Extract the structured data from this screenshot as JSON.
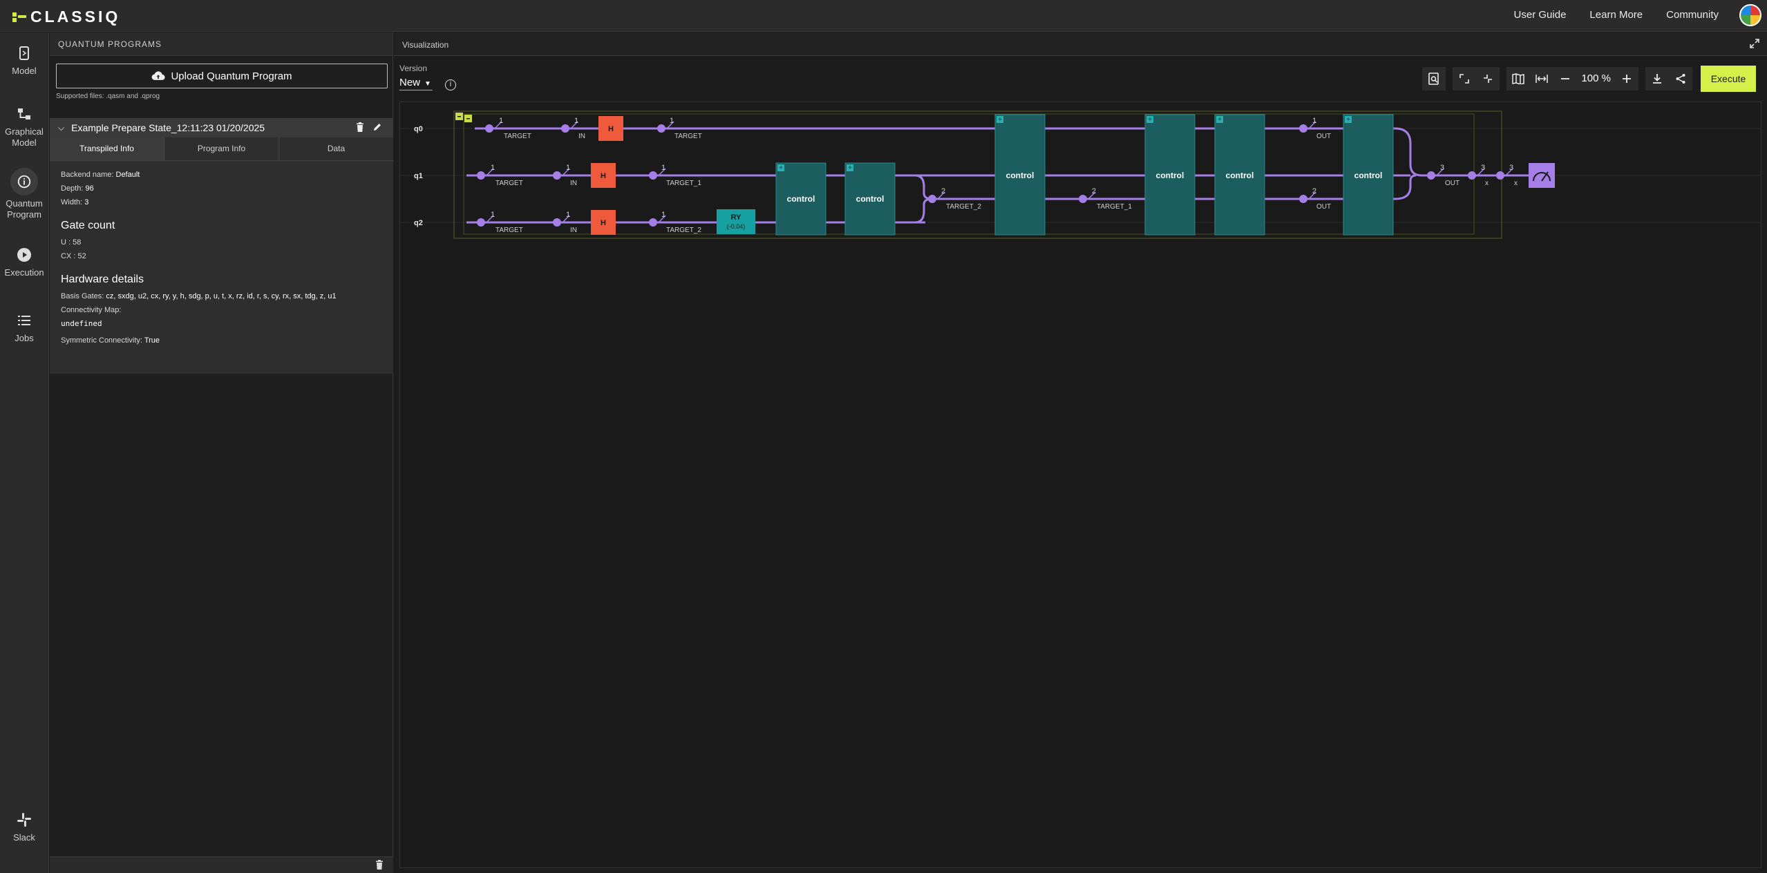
{
  "app": {
    "logo": "CLASSIQ",
    "top_links": [
      "User Guide",
      "Learn More",
      "Community"
    ]
  },
  "nav": {
    "items": [
      {
        "label_lines": [
          "Model"
        ],
        "icon": "model-icon"
      },
      {
        "label_lines": [
          "Graphical",
          "Model"
        ],
        "icon": "graphical-model-icon"
      },
      {
        "label_lines": [
          "Quantum",
          "Program"
        ],
        "icon": "info-circle-icon",
        "active": true
      },
      {
        "label_lines": [
          "Execution"
        ],
        "icon": "play-icon"
      },
      {
        "label_lines": [
          "Jobs"
        ],
        "icon": "list-icon"
      }
    ],
    "slack": "Slack"
  },
  "programs": {
    "header": "QUANTUM PROGRAMS",
    "upload_label": "Upload Quantum Program",
    "supported": "Supported files: .qasm and .qprog",
    "program_title": "Example Prepare State_12:11:23 01/20/2025",
    "tabs": [
      "Transpiled Info",
      "Program Info",
      "Data"
    ],
    "active_tab": "Transpiled Info",
    "backend_label": "Backend name: ",
    "backend_value": "Default",
    "depth_label": "Depth: ",
    "depth_value": "96",
    "width_label": "Width: ",
    "width_value": "3",
    "gate_count_title": "Gate count",
    "gate_u": "U : 58",
    "gate_cx": "CX : 52",
    "hardware_title": "Hardware details",
    "basis_label": "Basis Gates: ",
    "basis_value": "cz, sxdg, u2, cx, ry, y, h, sdg, p, u, t, x, rz, id, r, s, cy, rx, sx, tdg, z, u1",
    "connectivity_label": "Connectivity Map:",
    "connectivity_value": "undefined",
    "symmetric_label": "Symmetric Connectivity: ",
    "symmetric_value": "True"
  },
  "visualization": {
    "header": "Visualization",
    "version_label": "Version",
    "version_value": "New",
    "zoom": "100",
    "zoom_unit": "%",
    "execute_label": "Execute"
  },
  "circuit": {
    "qubits": [
      "q0",
      "q1",
      "q2"
    ],
    "labels": {
      "target": "TARGET",
      "target_1": "TARGET_1",
      "target_2": "TARGET_2",
      "in": "IN",
      "out": "OUT",
      "x": "x",
      "h": "H",
      "ry": "RY",
      "ry_param": "(-0.04)",
      "control": "control",
      "one": "1",
      "two": "2",
      "three": "3"
    }
  }
}
